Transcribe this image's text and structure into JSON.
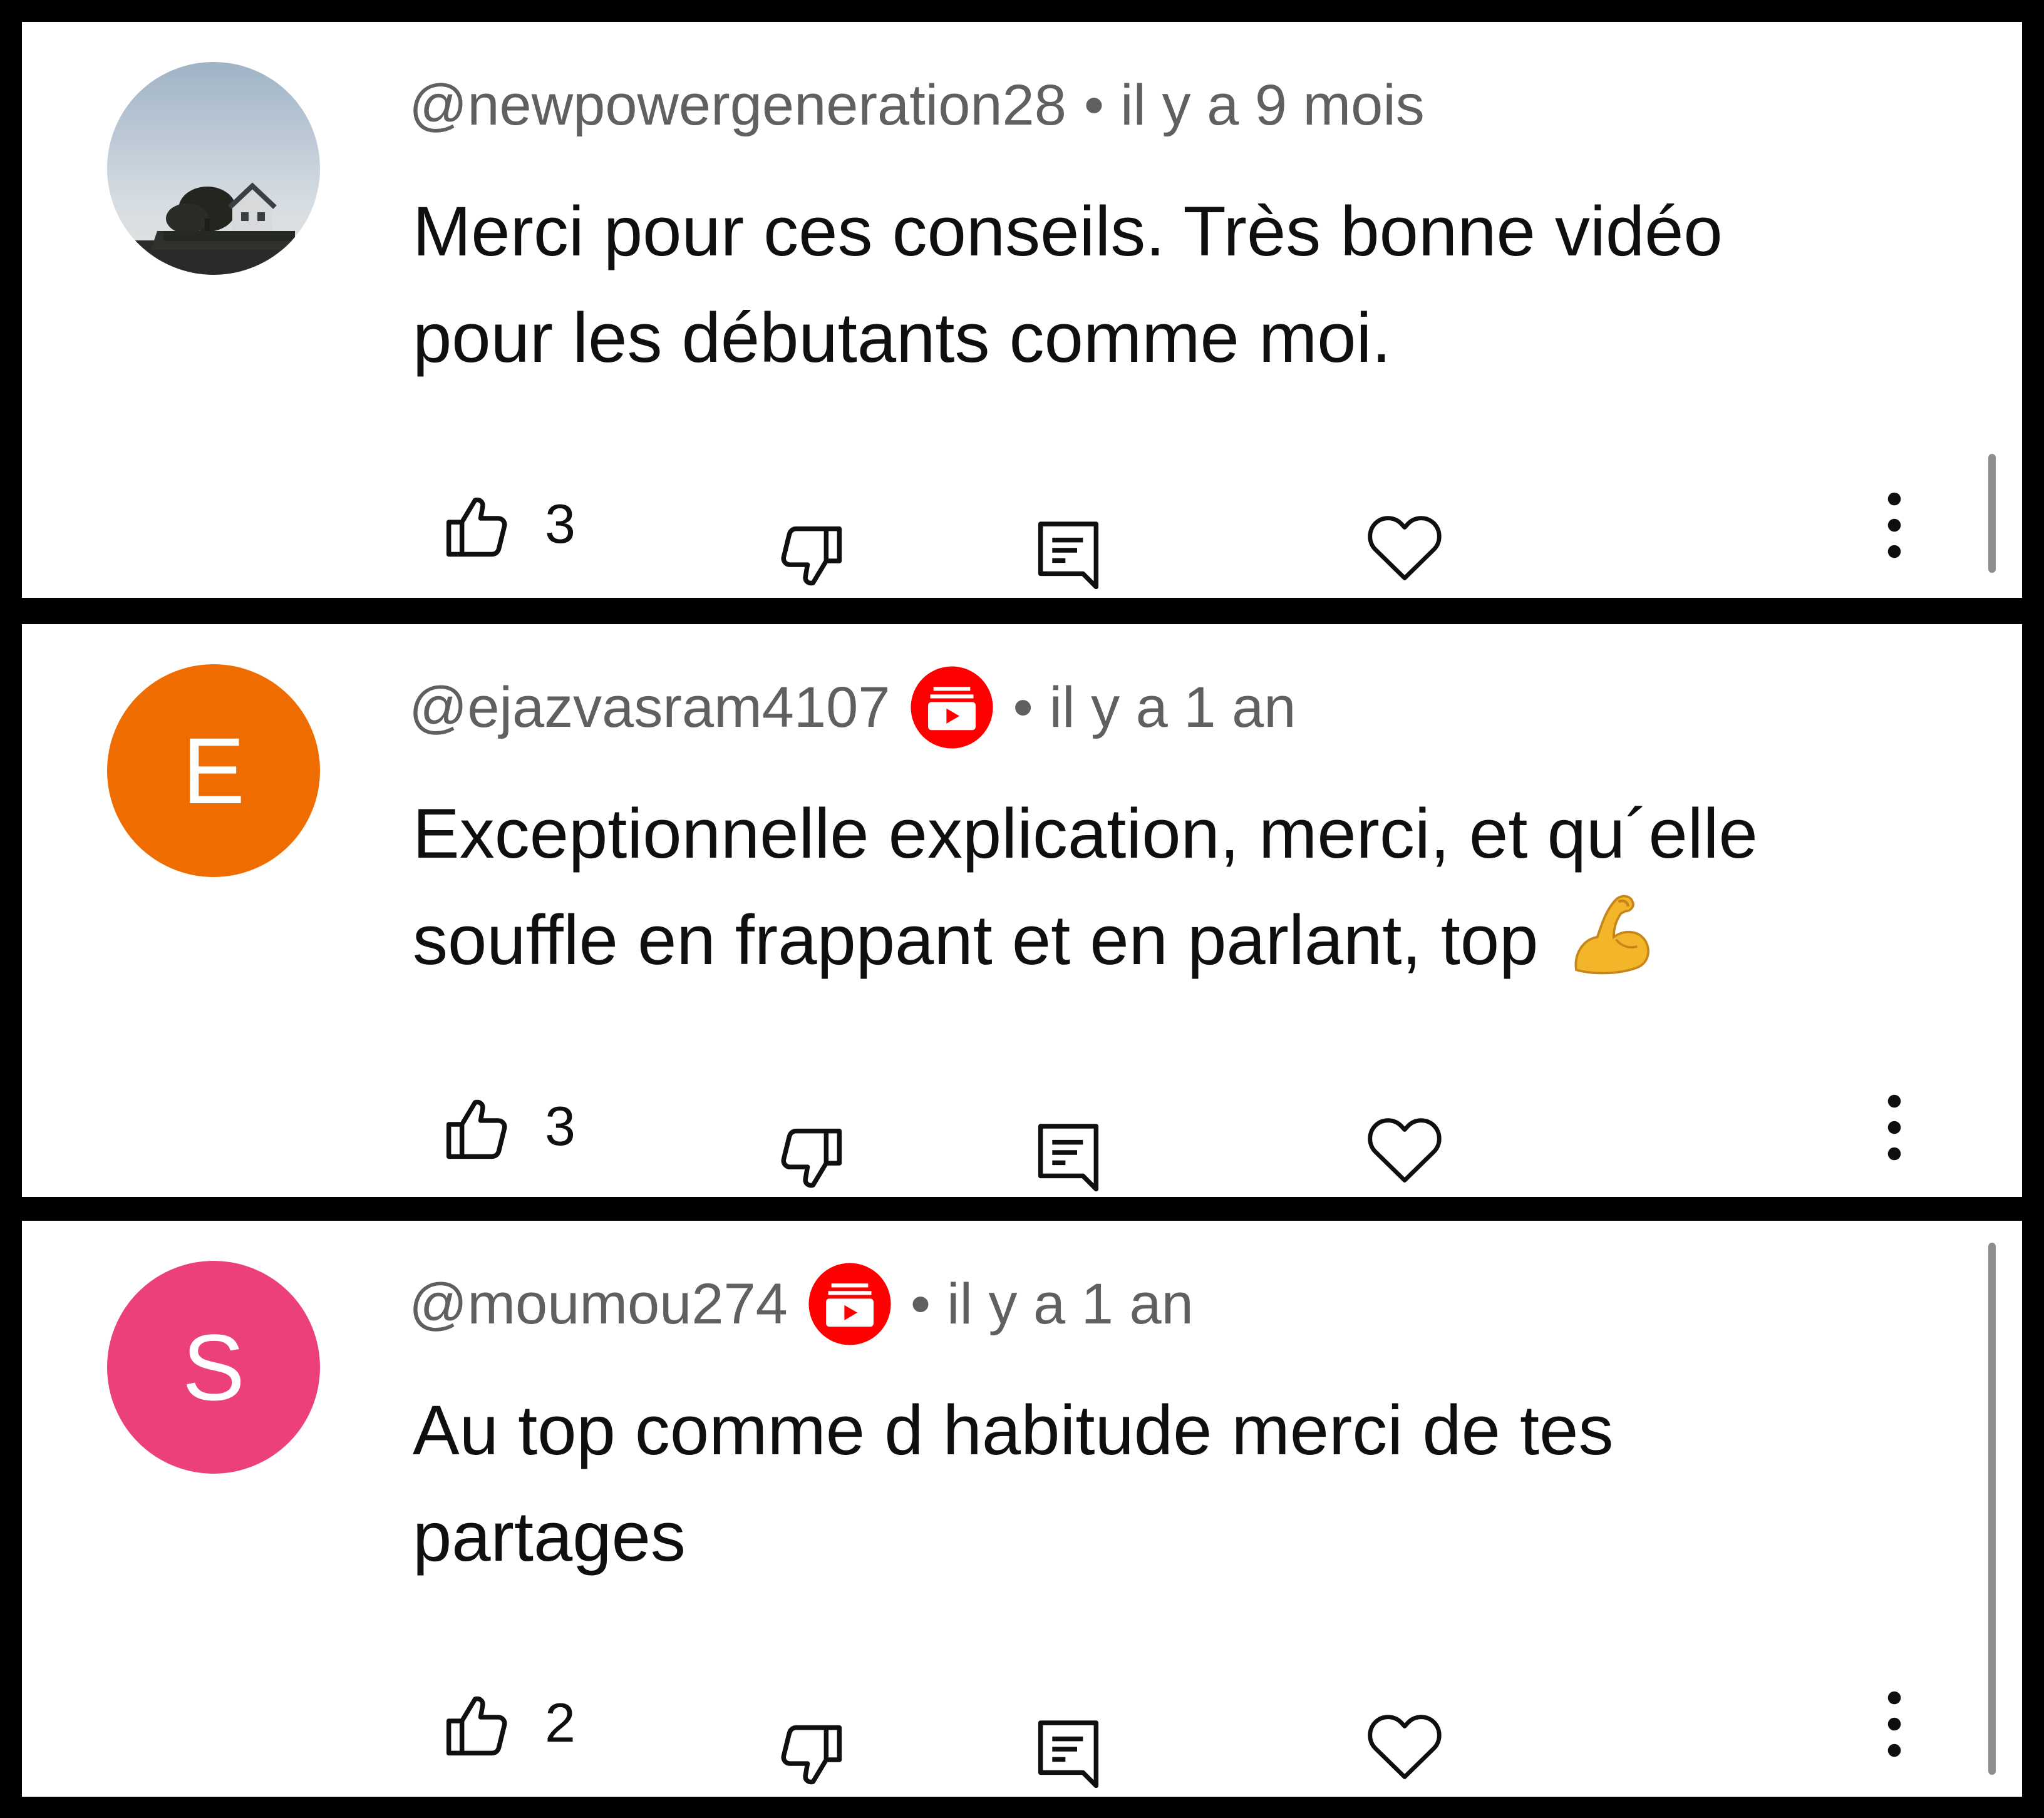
{
  "comments": [
    {
      "handle": "@newpowergeneration28",
      "age": "il y a 9 mois",
      "text_lines": [
        "Merci pour ces conseils. Très bonne vidéo",
        "pour les débutants comme moi."
      ],
      "avatar": {
        "type": "photo",
        "letter": ""
      },
      "likes": "3",
      "badge": false
    },
    {
      "handle": "@ejazvasram4107",
      "age": "il y a 1 an",
      "text_lines": [
        "Exceptionnelle explication, merci, et qu´elle",
        "souffle en frappant et en parlant, top"
      ],
      "emoji": "flexed-biceps-emoji",
      "avatar": {
        "type": "letter",
        "letter": "E",
        "color": "#ef6c00"
      },
      "likes": "3",
      "badge": true
    },
    {
      "handle": "@moumou274",
      "age": "il y a 1 an",
      "text_lines": [
        "Au top comme d habitude merci de tes",
        "partages"
      ],
      "avatar": {
        "type": "letter",
        "letter": "S",
        "color": "#ec407a"
      },
      "likes": "2",
      "badge": true
    }
  ],
  "separator": "•",
  "colors": {
    "badge_red": "#ff0000",
    "meta_gray": "#606060",
    "text": "#0f0f0f"
  },
  "icons": [
    "thumbs-up-icon",
    "thumbs-down-icon",
    "reply-icon",
    "heart-icon",
    "more-vert-icon",
    "member-badge-icon"
  ]
}
